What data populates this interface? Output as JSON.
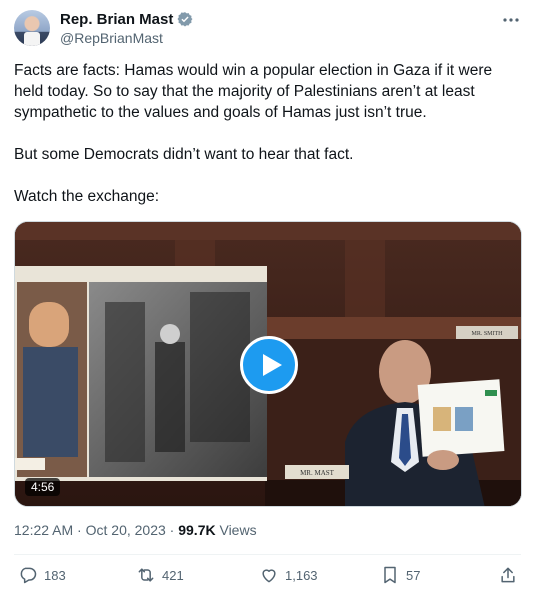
{
  "author": {
    "display_name": "Rep. Brian Mast",
    "handle": "@RepBrianMast"
  },
  "tweet": {
    "paragraphs": [
      "Facts are facts: Hamas would win a popular election in Gaza if it were held today. So to say that the majority of Palestinians aren’t at least sympathetic to the values and goals of Hamas just isn’t true.",
      "But some Democrats didn’t want to hear that fact.",
      "Watch the exchange:"
    ]
  },
  "media": {
    "duration": "4:56",
    "nameplate_left": "MR. MAST",
    "nameplate_right": "MR. SMITH"
  },
  "meta": {
    "time": "12:22 AM",
    "separator": " · ",
    "date": "Oct 20, 2023",
    "views_count": "99.7K",
    "views_label": "Views"
  },
  "actions": {
    "replies": "183",
    "reposts": "421",
    "likes": "1,163",
    "bookmarks": "57"
  },
  "colors": {
    "accent": "#1d9bf0",
    "secondary_text": "#536471",
    "primary_text": "#0f1419"
  },
  "icons": [
    "verified-badge-icon",
    "more-icon",
    "play-icon",
    "reply-icon",
    "repost-icon",
    "like-icon",
    "bookmark-icon",
    "share-icon"
  ]
}
